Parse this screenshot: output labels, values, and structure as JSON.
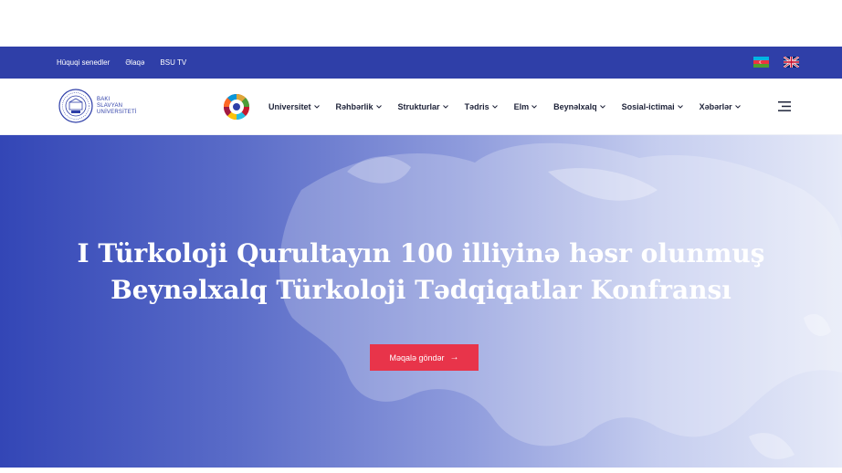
{
  "topbar": {
    "links": [
      {
        "label": "Hüquqi senedler"
      },
      {
        "label": "Əlaqə"
      },
      {
        "label": "BSU TV"
      }
    ],
    "flags": [
      "azerbaijan-flag-icon",
      "uk-flag-icon"
    ]
  },
  "logo": {
    "lines": [
      "BAKI",
      "SLAVYAN",
      "UNİVERSİTETİ"
    ]
  },
  "menu": {
    "items": [
      {
        "label": "Universitet"
      },
      {
        "label": "Rəhbərlik"
      },
      {
        "label": "Strukturlar"
      },
      {
        "label": "Tədris"
      },
      {
        "label": "Elm"
      },
      {
        "label": "Beynəlxalq"
      },
      {
        "label": "Sosial-ictimai"
      },
      {
        "label": "Xəbərlər"
      }
    ]
  },
  "hero": {
    "title_line1": "I Türkoloji Qurultayın 100 illiyinə həsr olunmuş",
    "title_line2": "Beynəlxalq Türkoloji Tədqiqatlar Konfransı",
    "button_label": "Məqalə göndər",
    "button_arrow": "→"
  },
  "colors": {
    "brand_blue": "#2f3fa8",
    "accent_red": "#e8344a",
    "menu_text": "#1d2238"
  }
}
